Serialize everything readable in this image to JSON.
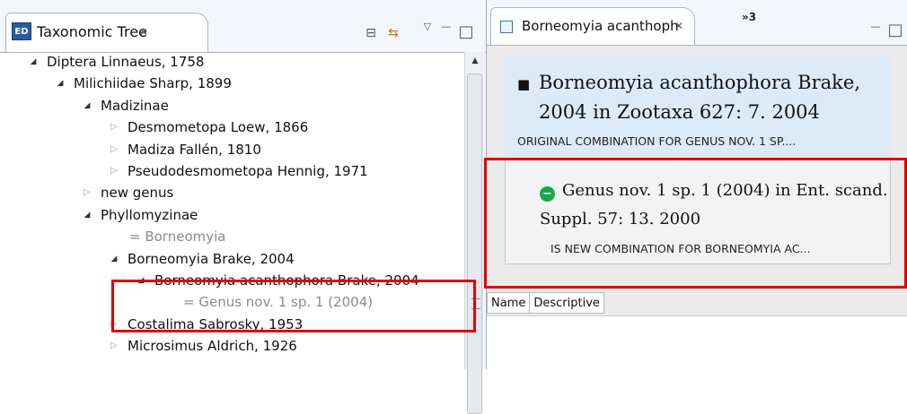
{
  "left_view": {
    "tab_title": "Taxonomic Tree",
    "tab_icon_text": "ED",
    "tree": [
      {
        "label": "Diptera Linnaeus, 1758",
        "indent": 0,
        "toggle": "open",
        "kind": "taxon"
      },
      {
        "label": "Milichiidae Sharp, 1899",
        "indent": 1,
        "toggle": "open",
        "kind": "taxon"
      },
      {
        "label": "Madizinae",
        "indent": 2,
        "toggle": "open",
        "kind": "taxon"
      },
      {
        "label": "Desmometopa Loew, 1866",
        "indent": 3,
        "toggle": "closed",
        "kind": "taxon"
      },
      {
        "label": "Madiza Fallén, 1810",
        "indent": 3,
        "toggle": "closed",
        "kind": "taxon"
      },
      {
        "label": "Pseudodesmometopa Hennig, 1971",
        "indent": 3,
        "toggle": "closed",
        "kind": "taxon"
      },
      {
        "label": "new genus",
        "indent": 2,
        "toggle": "closed",
        "kind": "taxon"
      },
      {
        "label": "Phyllomyzinae",
        "indent": 2,
        "toggle": "open",
        "kind": "taxon"
      },
      {
        "label": "= Borneomyia",
        "indent": 3,
        "toggle": "none",
        "kind": "synonym"
      },
      {
        "label": "Borneomyia Brake, 2004",
        "indent": 3,
        "toggle": "open",
        "kind": "taxon"
      },
      {
        "label": "Borneomyia acanthophora Brake, 2004",
        "indent": 4,
        "toggle": "open",
        "kind": "taxon"
      },
      {
        "label": "= Genus nov. 1 sp. 1 (2004)",
        "indent": 5,
        "toggle": "none",
        "kind": "synonym"
      },
      {
        "label": "Costalima Sabrosky, 1953",
        "indent": 3,
        "toggle": "closed",
        "kind": "taxon"
      },
      {
        "label": "Microsimus Aldrich, 1926",
        "indent": 3,
        "toggle": "closed",
        "kind": "taxon"
      }
    ]
  },
  "right_view": {
    "tab_title": "Borneomyia acanthoph",
    "overflow_count": "»3",
    "accepted_name": {
      "bullet": "■",
      "line1": "Borneomyia acanthophora Brake,",
      "line2": "2004 in Zootaxa 627: 7. 2004",
      "caption": "ORIGINAL COMBINATION FOR GENUS NOV. 1 SP...."
    },
    "synonym": {
      "line1": "Genus nov. 1 sp. 1 (2004) in Ent. scand.",
      "line2": "Suppl. 57: 13. 2000",
      "caption": "IS NEW COMBINATION FOR BORNEOMYIA AC..."
    },
    "bottom_tabs": [
      "Name",
      "Descriptive"
    ]
  },
  "icons": {
    "close": "✕",
    "collapse_all": "⊟",
    "link_editor": "⇆",
    "view_menu": "▽",
    "minimize": "—",
    "maximize": "□",
    "twisty_open": "◢",
    "twisty_closed": "▷",
    "scroll_up": "▲",
    "homotypic_marker": "−"
  },
  "colors": {
    "highlight_red": "#e00000",
    "homotypic_green": "#18a84c",
    "accepted_name_bg": "#ddeaf7",
    "synonym_text": "#8a8a8a"
  }
}
